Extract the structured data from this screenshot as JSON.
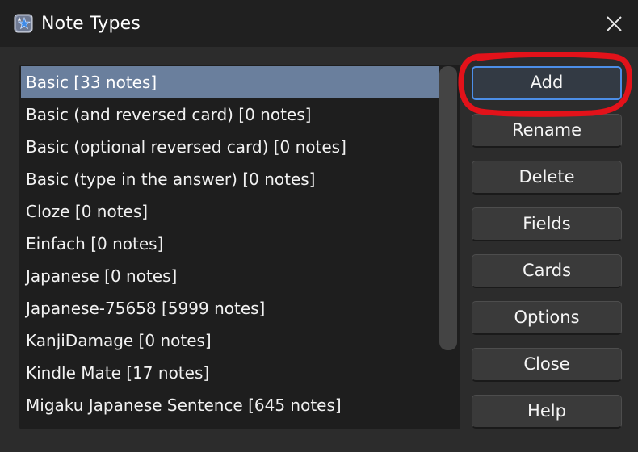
{
  "window": {
    "title": "Note Types"
  },
  "note_types": [
    {
      "label": "Basic [33 notes]",
      "selected": true
    },
    {
      "label": "Basic (and reversed card) [0 notes]",
      "selected": false
    },
    {
      "label": "Basic (optional reversed card) [0 notes]",
      "selected": false
    },
    {
      "label": "Basic (type in the answer) [0 notes]",
      "selected": false
    },
    {
      "label": "Cloze [0 notes]",
      "selected": false
    },
    {
      "label": "Einfach [0 notes]",
      "selected": false
    },
    {
      "label": "Japanese [0 notes]",
      "selected": false
    },
    {
      "label": "Japanese-75658 [5999 notes]",
      "selected": false
    },
    {
      "label": "KanjiDamage [0 notes]",
      "selected": false
    },
    {
      "label": "Kindle Mate [17 notes]",
      "selected": false
    },
    {
      "label": "Migaku Japanese Sentence [645 notes]",
      "selected": false
    }
  ],
  "buttons": {
    "add": "Add",
    "rename": "Rename",
    "delete": "Delete",
    "fields": "Fields",
    "cards": "Cards",
    "options": "Options",
    "close": "Close",
    "help": "Help"
  },
  "colors": {
    "selection": "#6a7f9d",
    "focus_ring": "#4c8ee8",
    "annotation": "#e3121a"
  },
  "icons": {
    "app": "anki-star-icon",
    "close": "close-icon"
  }
}
